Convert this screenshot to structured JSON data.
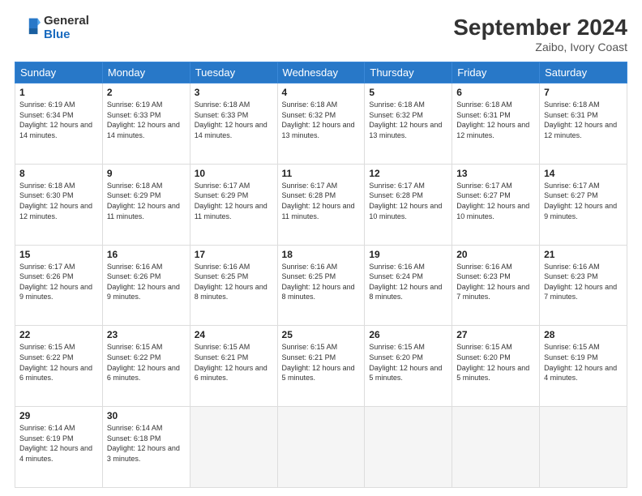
{
  "header": {
    "logo_general": "General",
    "logo_blue": "Blue",
    "month_title": "September 2024",
    "subtitle": "Zaibo, Ivory Coast"
  },
  "days_of_week": [
    "Sunday",
    "Monday",
    "Tuesday",
    "Wednesday",
    "Thursday",
    "Friday",
    "Saturday"
  ],
  "weeks": [
    [
      {
        "day": "1",
        "sunrise": "6:19 AM",
        "sunset": "6:34 PM",
        "daylight": "12 hours and 14 minutes."
      },
      {
        "day": "2",
        "sunrise": "6:19 AM",
        "sunset": "6:33 PM",
        "daylight": "12 hours and 14 minutes."
      },
      {
        "day": "3",
        "sunrise": "6:18 AM",
        "sunset": "6:33 PM",
        "daylight": "12 hours and 14 minutes."
      },
      {
        "day": "4",
        "sunrise": "6:18 AM",
        "sunset": "6:32 PM",
        "daylight": "12 hours and 13 minutes."
      },
      {
        "day": "5",
        "sunrise": "6:18 AM",
        "sunset": "6:32 PM",
        "daylight": "12 hours and 13 minutes."
      },
      {
        "day": "6",
        "sunrise": "6:18 AM",
        "sunset": "6:31 PM",
        "daylight": "12 hours and 12 minutes."
      },
      {
        "day": "7",
        "sunrise": "6:18 AM",
        "sunset": "6:31 PM",
        "daylight": "12 hours and 12 minutes."
      }
    ],
    [
      {
        "day": "8",
        "sunrise": "6:18 AM",
        "sunset": "6:30 PM",
        "daylight": "12 hours and 12 minutes."
      },
      {
        "day": "9",
        "sunrise": "6:18 AM",
        "sunset": "6:29 PM",
        "daylight": "12 hours and 11 minutes."
      },
      {
        "day": "10",
        "sunrise": "6:17 AM",
        "sunset": "6:29 PM",
        "daylight": "12 hours and 11 minutes."
      },
      {
        "day": "11",
        "sunrise": "6:17 AM",
        "sunset": "6:28 PM",
        "daylight": "12 hours and 11 minutes."
      },
      {
        "day": "12",
        "sunrise": "6:17 AM",
        "sunset": "6:28 PM",
        "daylight": "12 hours and 10 minutes."
      },
      {
        "day": "13",
        "sunrise": "6:17 AM",
        "sunset": "6:27 PM",
        "daylight": "12 hours and 10 minutes."
      },
      {
        "day": "14",
        "sunrise": "6:17 AM",
        "sunset": "6:27 PM",
        "daylight": "12 hours and 9 minutes."
      }
    ],
    [
      {
        "day": "15",
        "sunrise": "6:17 AM",
        "sunset": "6:26 PM",
        "daylight": "12 hours and 9 minutes."
      },
      {
        "day": "16",
        "sunrise": "6:16 AM",
        "sunset": "6:26 PM",
        "daylight": "12 hours and 9 minutes."
      },
      {
        "day": "17",
        "sunrise": "6:16 AM",
        "sunset": "6:25 PM",
        "daylight": "12 hours and 8 minutes."
      },
      {
        "day": "18",
        "sunrise": "6:16 AM",
        "sunset": "6:25 PM",
        "daylight": "12 hours and 8 minutes."
      },
      {
        "day": "19",
        "sunrise": "6:16 AM",
        "sunset": "6:24 PM",
        "daylight": "12 hours and 8 minutes."
      },
      {
        "day": "20",
        "sunrise": "6:16 AM",
        "sunset": "6:23 PM",
        "daylight": "12 hours and 7 minutes."
      },
      {
        "day": "21",
        "sunrise": "6:16 AM",
        "sunset": "6:23 PM",
        "daylight": "12 hours and 7 minutes."
      }
    ],
    [
      {
        "day": "22",
        "sunrise": "6:15 AM",
        "sunset": "6:22 PM",
        "daylight": "12 hours and 6 minutes."
      },
      {
        "day": "23",
        "sunrise": "6:15 AM",
        "sunset": "6:22 PM",
        "daylight": "12 hours and 6 minutes."
      },
      {
        "day": "24",
        "sunrise": "6:15 AM",
        "sunset": "6:21 PM",
        "daylight": "12 hours and 6 minutes."
      },
      {
        "day": "25",
        "sunrise": "6:15 AM",
        "sunset": "6:21 PM",
        "daylight": "12 hours and 5 minutes."
      },
      {
        "day": "26",
        "sunrise": "6:15 AM",
        "sunset": "6:20 PM",
        "daylight": "12 hours and 5 minutes."
      },
      {
        "day": "27",
        "sunrise": "6:15 AM",
        "sunset": "6:20 PM",
        "daylight": "12 hours and 5 minutes."
      },
      {
        "day": "28",
        "sunrise": "6:15 AM",
        "sunset": "6:19 PM",
        "daylight": "12 hours and 4 minutes."
      }
    ],
    [
      {
        "day": "29",
        "sunrise": "6:14 AM",
        "sunset": "6:19 PM",
        "daylight": "12 hours and 4 minutes."
      },
      {
        "day": "30",
        "sunrise": "6:14 AM",
        "sunset": "6:18 PM",
        "daylight": "12 hours and 3 minutes."
      },
      null,
      null,
      null,
      null,
      null
    ]
  ]
}
